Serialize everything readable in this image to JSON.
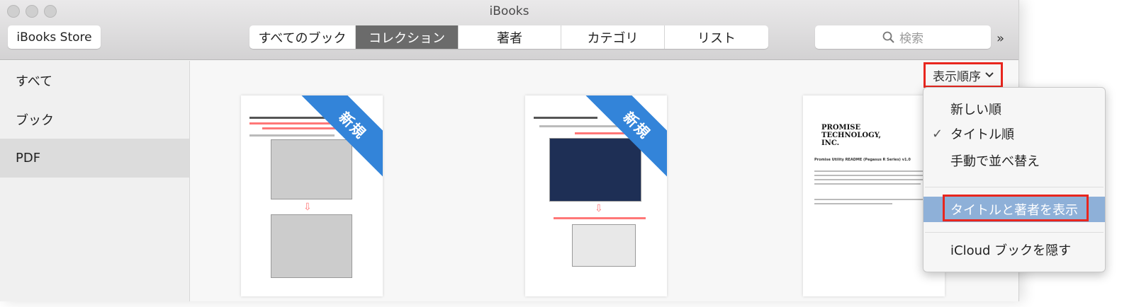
{
  "window": {
    "title": "iBooks"
  },
  "toolbar": {
    "store_label": "iBooks Store",
    "tabs": [
      {
        "label": "すべてのブック"
      },
      {
        "label": "コレクション",
        "selected": true
      },
      {
        "label": "著者"
      },
      {
        "label": "カテゴリ"
      },
      {
        "label": "リスト"
      }
    ],
    "search_placeholder": "検索",
    "overflow": "»"
  },
  "sidebar": {
    "items": [
      {
        "label": "すべて"
      },
      {
        "label": "ブック"
      },
      {
        "label": "PDF",
        "selected": true
      }
    ]
  },
  "sort": {
    "label": "表示順序",
    "chevron": "⌄"
  },
  "books": [
    {
      "badge": "新規"
    },
    {
      "badge": "新規"
    },
    {
      "logo": "PROMISE TECHNOLOGY, INC.",
      "heading": "Promise Utility README (Pegasus R Series) v1.0"
    }
  ],
  "menu": {
    "items": [
      {
        "label": "新しい順"
      },
      {
        "label": "タイトル順",
        "checked": true,
        "check": "✓"
      },
      {
        "label": "手動で並べ替え"
      },
      {
        "label": "タイトルと著者を表示",
        "highlighted": true
      },
      {
        "label": "iCloud ブックを隠す"
      }
    ]
  },
  "colors": {
    "accent_red": "#e8261e",
    "badge_blue": "#3384d9",
    "highlight": "#8eb0d8"
  }
}
